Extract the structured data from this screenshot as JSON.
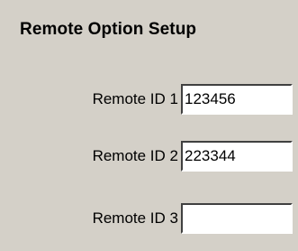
{
  "title": "Remote Option Setup",
  "remote_ids": [
    {
      "label": "Remote ID 1",
      "value": "123456"
    },
    {
      "label": "Remote ID 2",
      "value": "223344"
    },
    {
      "label": "Remote ID 3",
      "value": ""
    }
  ],
  "colors": {
    "background": "#d4d0c8",
    "field_background": "#ffffff",
    "text": "#000000"
  }
}
